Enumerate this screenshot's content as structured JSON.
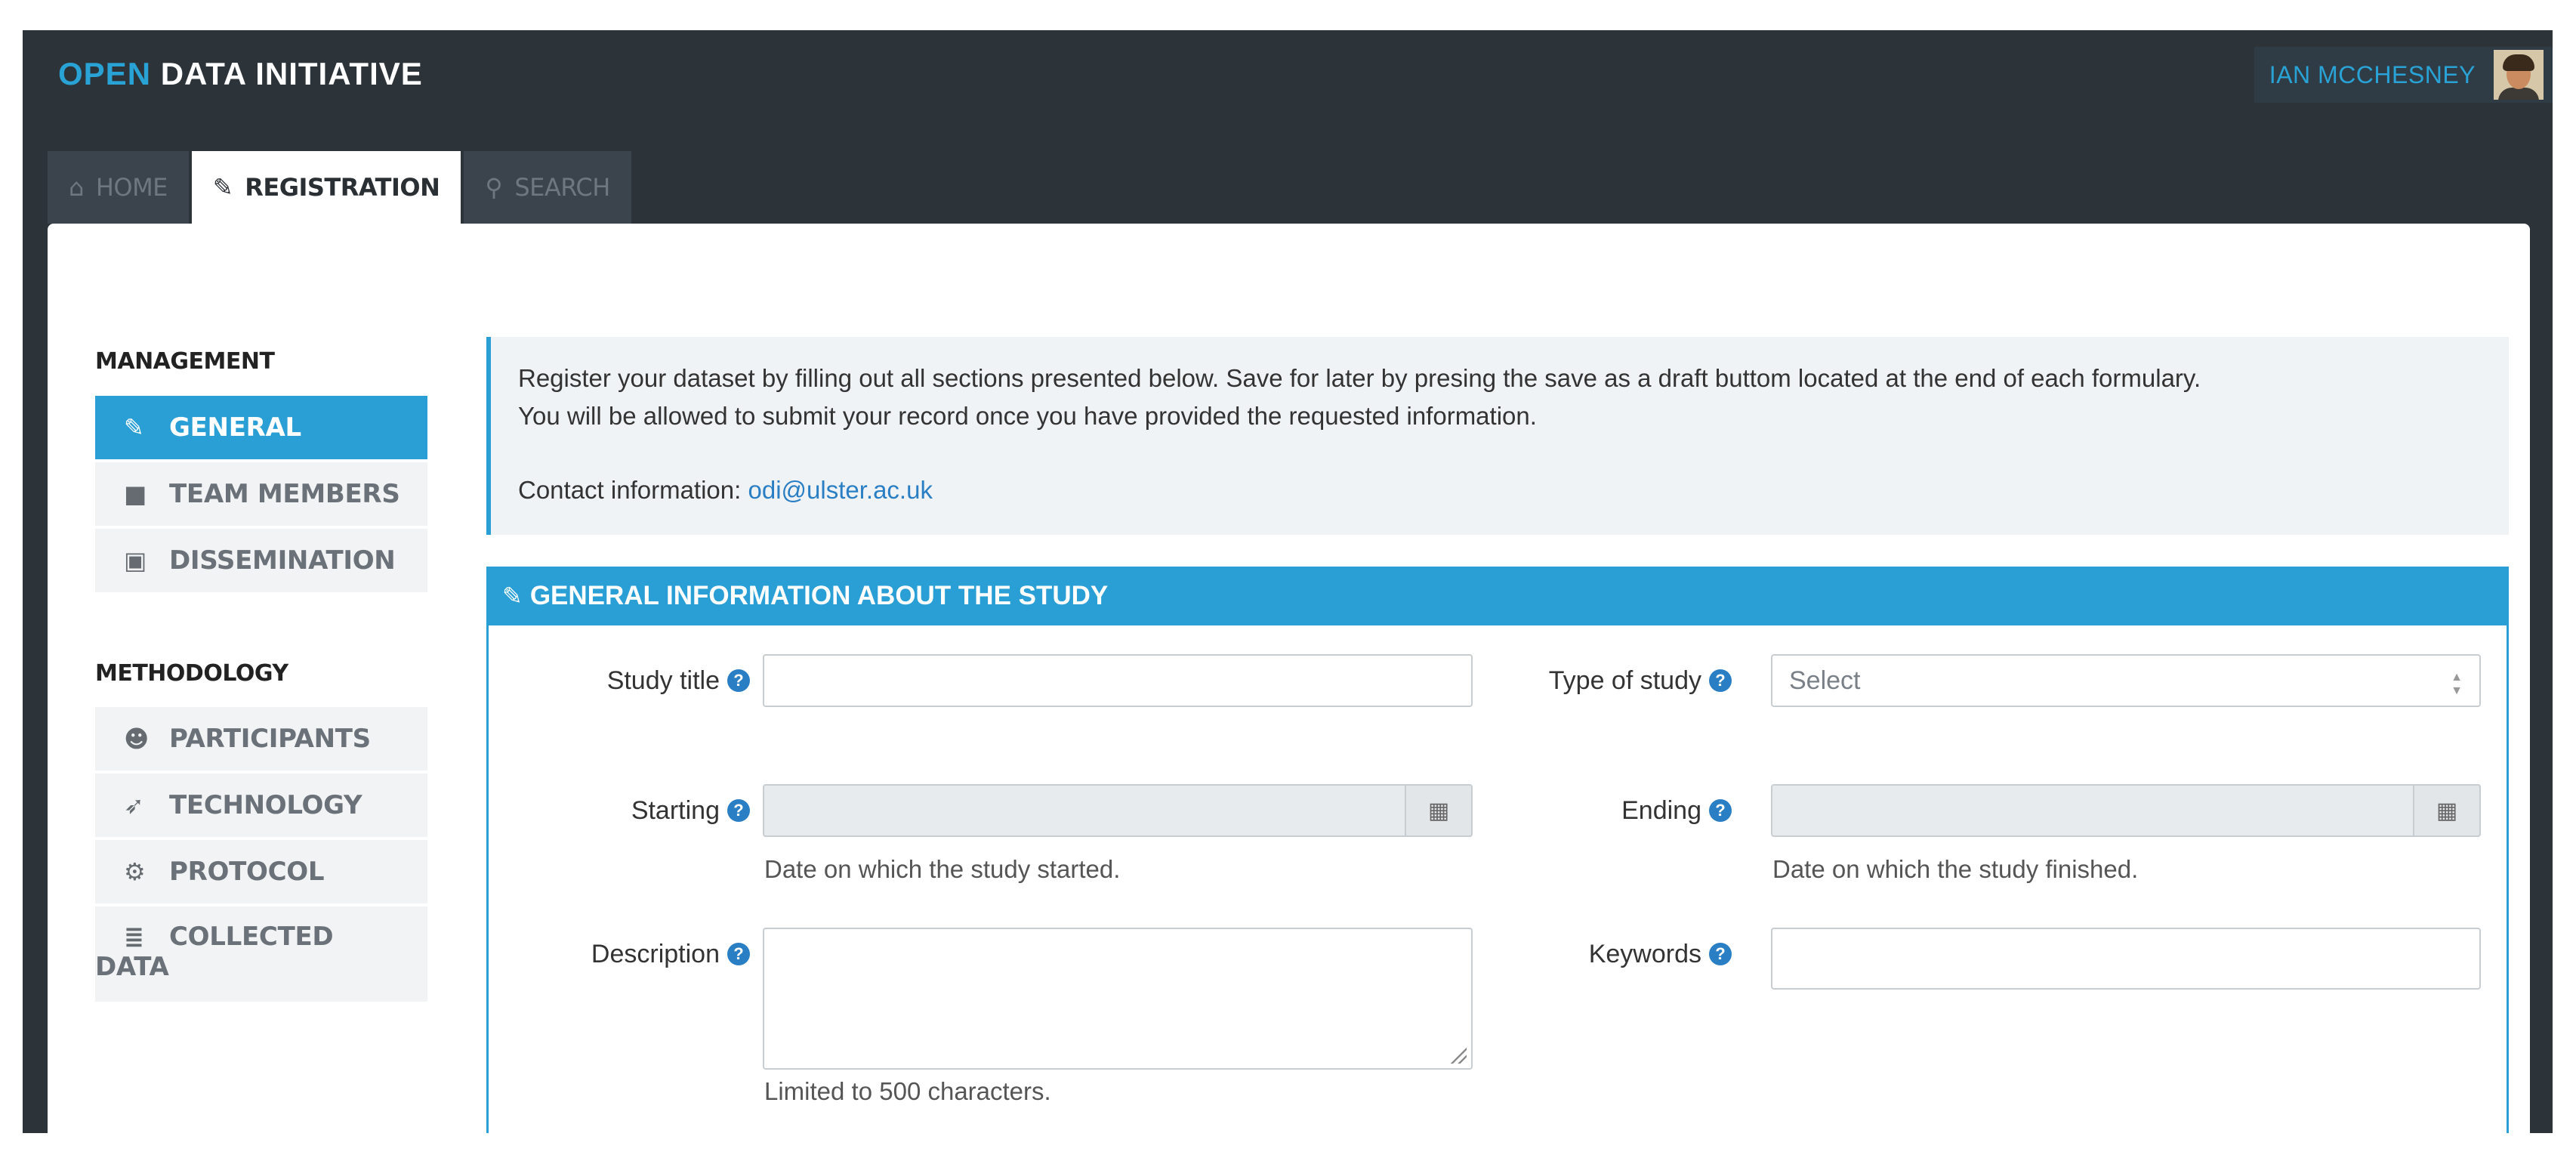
{
  "app": {
    "brand_part1": "OPEN",
    "brand_part2": "DATA INITIATIVE"
  },
  "user": {
    "name": "IAN MCCHESNEY"
  },
  "tabs": [
    {
      "label": "HOME",
      "icon": "home-icon",
      "active": false
    },
    {
      "label": "REGISTRATION",
      "icon": "edit-icon",
      "active": true
    },
    {
      "label": "SEARCH",
      "icon": "search-icon",
      "active": false
    }
  ],
  "sidebar": {
    "management_heading": "MANAGEMENT",
    "management_items": [
      {
        "label": "GENERAL",
        "icon": "pencil-icon",
        "active": true
      },
      {
        "label": "TEAM MEMBERS",
        "icon": "lock-icon",
        "active": false
      },
      {
        "label": "DISSEMINATION",
        "icon": "presentation-icon",
        "active": false
      }
    ],
    "methodology_heading": "METHODOLOGY",
    "methodology_items": [
      {
        "label": "PARTICIPANTS",
        "icon": "users-icon",
        "active": false
      },
      {
        "label": "TECHNOLOGY",
        "icon": "rocket-icon",
        "active": false
      },
      {
        "label": "PROTOCOL",
        "icon": "cogs-icon",
        "active": false
      },
      {
        "label_line1": "COLLECTED",
        "label_line2": "DATA",
        "icon": "database-icon",
        "active": false
      }
    ]
  },
  "info": {
    "line1": "Register your dataset by filling out all sections presented below. Save for later by presing the save as a draft buttom located at the end of each formulary.",
    "line2": "You will be allowed to submit your record once you have provided the requested information.",
    "contact_label": "Contact information: ",
    "contact_email": "odi@ulster.ac.uk"
  },
  "form": {
    "section_title": "GENERAL INFORMATION ABOUT THE STUDY",
    "study_title_label": "Study title",
    "study_title_value": "",
    "type_of_study_label": "Type of study",
    "type_of_study_value": "Select",
    "starting_label": "Starting",
    "starting_hint": "Date on which the study started.",
    "ending_label": "Ending",
    "ending_hint": "Date on which the study finished.",
    "description_label": "Description",
    "description_hint": "Limited to 500 characters.",
    "keywords_label": "Keywords",
    "keywords_value": ""
  },
  "colors": {
    "accent": "#2a9fd6",
    "topbar": "#2c3339",
    "brand_blue": "#29a3d6"
  }
}
